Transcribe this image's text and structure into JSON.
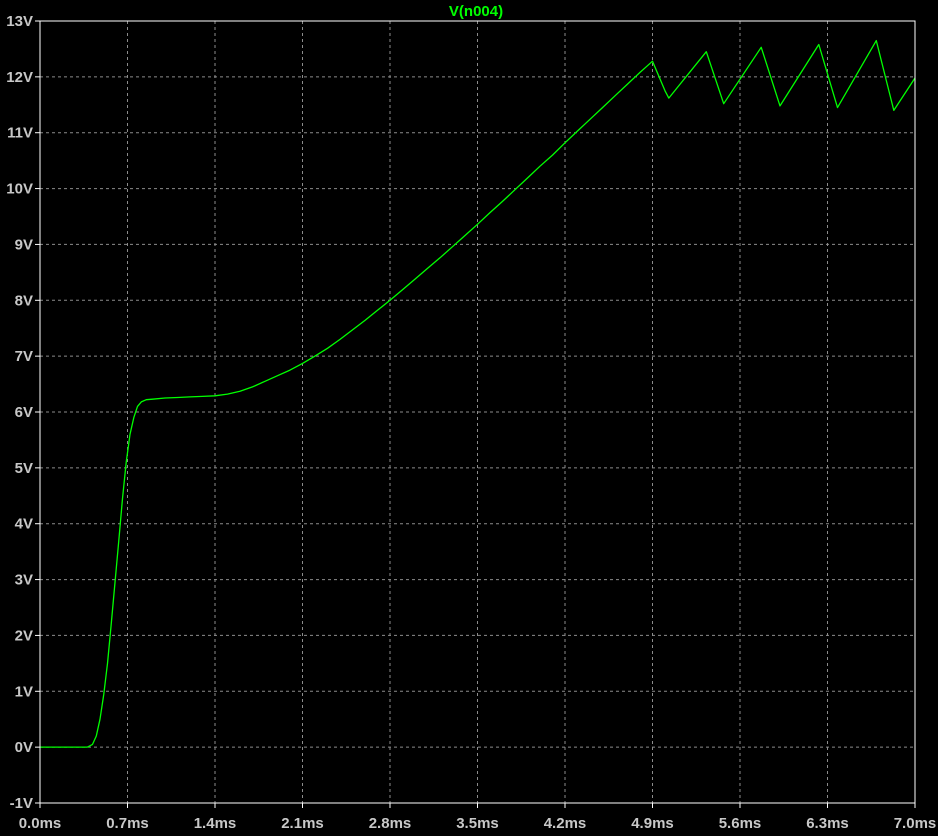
{
  "chart_data": {
    "type": "line",
    "title": "V(n004)",
    "xlabel": "",
    "ylabel": "",
    "x_unit": "ms",
    "y_unit": "V",
    "xlim": [
      0.0,
      7.0
    ],
    "ylim": [
      -1,
      13
    ],
    "grid": true,
    "x_ticks": [
      "0.0ms",
      "0.7ms",
      "1.4ms",
      "2.1ms",
      "2.8ms",
      "3.5ms",
      "4.2ms",
      "4.9ms",
      "5.6ms",
      "6.3ms",
      "7.0ms"
    ],
    "y_ticks": [
      "-1V",
      "0V",
      "1V",
      "2V",
      "3V",
      "4V",
      "5V",
      "6V",
      "7V",
      "8V",
      "9V",
      "10V",
      "11V",
      "12V",
      "13V"
    ],
    "colors": {
      "background": "#000000",
      "trace": "#00ff00",
      "grid": "#8c8c8c",
      "frame": "#ffffff",
      "tick_text": "#c8c8c8"
    },
    "series": [
      {
        "name": "V(n004)",
        "x": [
          0.0,
          0.2,
          0.38,
          0.42,
          0.45,
          0.48,
          0.51,
          0.54,
          0.57,
          0.6,
          0.63,
          0.66,
          0.69,
          0.72,
          0.75,
          0.78,
          0.81,
          0.85,
          0.9,
          1.0,
          1.1,
          1.2,
          1.3,
          1.4,
          1.5,
          1.6,
          1.7,
          1.8,
          1.9,
          2.0,
          2.1,
          2.2,
          2.3,
          2.4,
          2.5,
          2.6,
          2.7,
          2.8,
          2.9,
          3.0,
          3.1,
          3.2,
          3.3,
          3.4,
          3.5,
          3.6,
          3.7,
          3.8,
          3.9,
          4.0,
          4.1,
          4.2,
          4.3,
          4.4,
          4.5,
          4.6,
          4.7,
          4.8,
          4.86,
          4.9,
          5.0,
          5.03,
          5.33,
          5.47,
          5.77,
          5.92,
          6.23,
          6.38,
          6.69,
          6.83,
          7.0
        ],
        "y": [
          0.0,
          0.0,
          0.0,
          0.05,
          0.2,
          0.5,
          0.95,
          1.5,
          2.2,
          2.95,
          3.7,
          4.45,
          5.1,
          5.6,
          5.9,
          6.1,
          6.18,
          6.22,
          6.23,
          6.25,
          6.26,
          6.27,
          6.28,
          6.29,
          6.32,
          6.37,
          6.45,
          6.55,
          6.65,
          6.75,
          6.87,
          7.0,
          7.14,
          7.3,
          7.47,
          7.64,
          7.82,
          8.0,
          8.19,
          8.38,
          8.57,
          8.76,
          8.96,
          9.16,
          9.36,
          9.57,
          9.77,
          9.98,
          10.19,
          10.4,
          10.6,
          10.82,
          11.03,
          11.24,
          11.45,
          11.66,
          11.87,
          12.08,
          12.2,
          12.28,
          11.75,
          11.62,
          12.45,
          11.52,
          12.53,
          11.48,
          12.58,
          11.45,
          12.65,
          11.4,
          11.98
        ]
      }
    ]
  }
}
